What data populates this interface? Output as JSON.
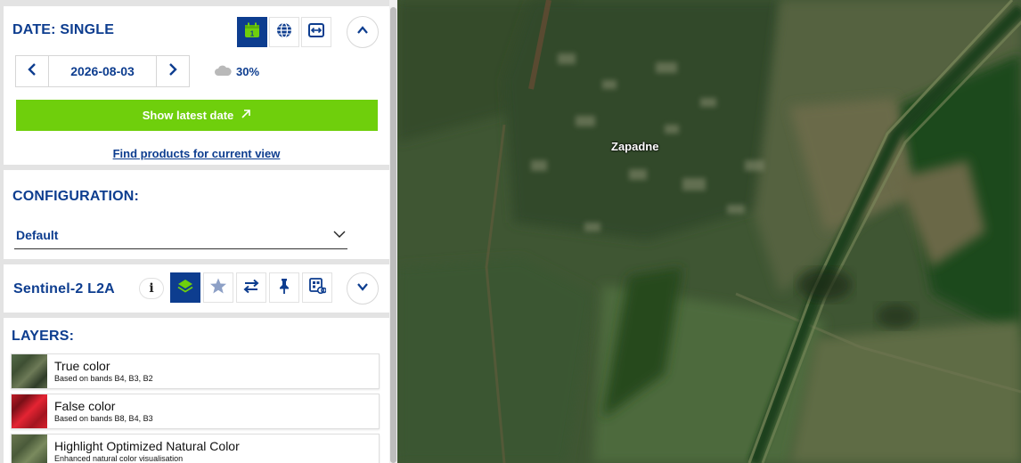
{
  "date_panel": {
    "title": "DATE: SINGLE",
    "modes": [
      {
        "name": "single-date",
        "icon": "calendar-icon",
        "active": true
      },
      {
        "name": "timelapse-globe",
        "icon": "globe-icon",
        "active": false
      },
      {
        "name": "compare-dates",
        "icon": "compare-arrows-icon",
        "active": false
      }
    ],
    "calendar_day": "1",
    "selected_date": "2026-08-03",
    "cloud_coverage": "30%",
    "latest_button_label": "Show latest date",
    "find_products_link": "Find products for current view"
  },
  "configuration": {
    "title": "CONFIGURATION:",
    "selected": "Default"
  },
  "collection": {
    "name": "Sentinel-2 L2A",
    "info_label": "i"
  },
  "layers": {
    "title": "LAYERS:",
    "items": [
      {
        "name": "True color",
        "description": "Based on bands B4, B3, B2"
      },
      {
        "name": "False color",
        "description": "Based on bands B8, B4, B3"
      },
      {
        "name": "Highlight Optimized Natural Color",
        "description": "Enhanced natural color visualisation"
      }
    ]
  },
  "map": {
    "place_label": "Zapadne"
  },
  "colors": {
    "brand_blue": "#0d3d8f",
    "accent_green": "#6fcf0c"
  }
}
